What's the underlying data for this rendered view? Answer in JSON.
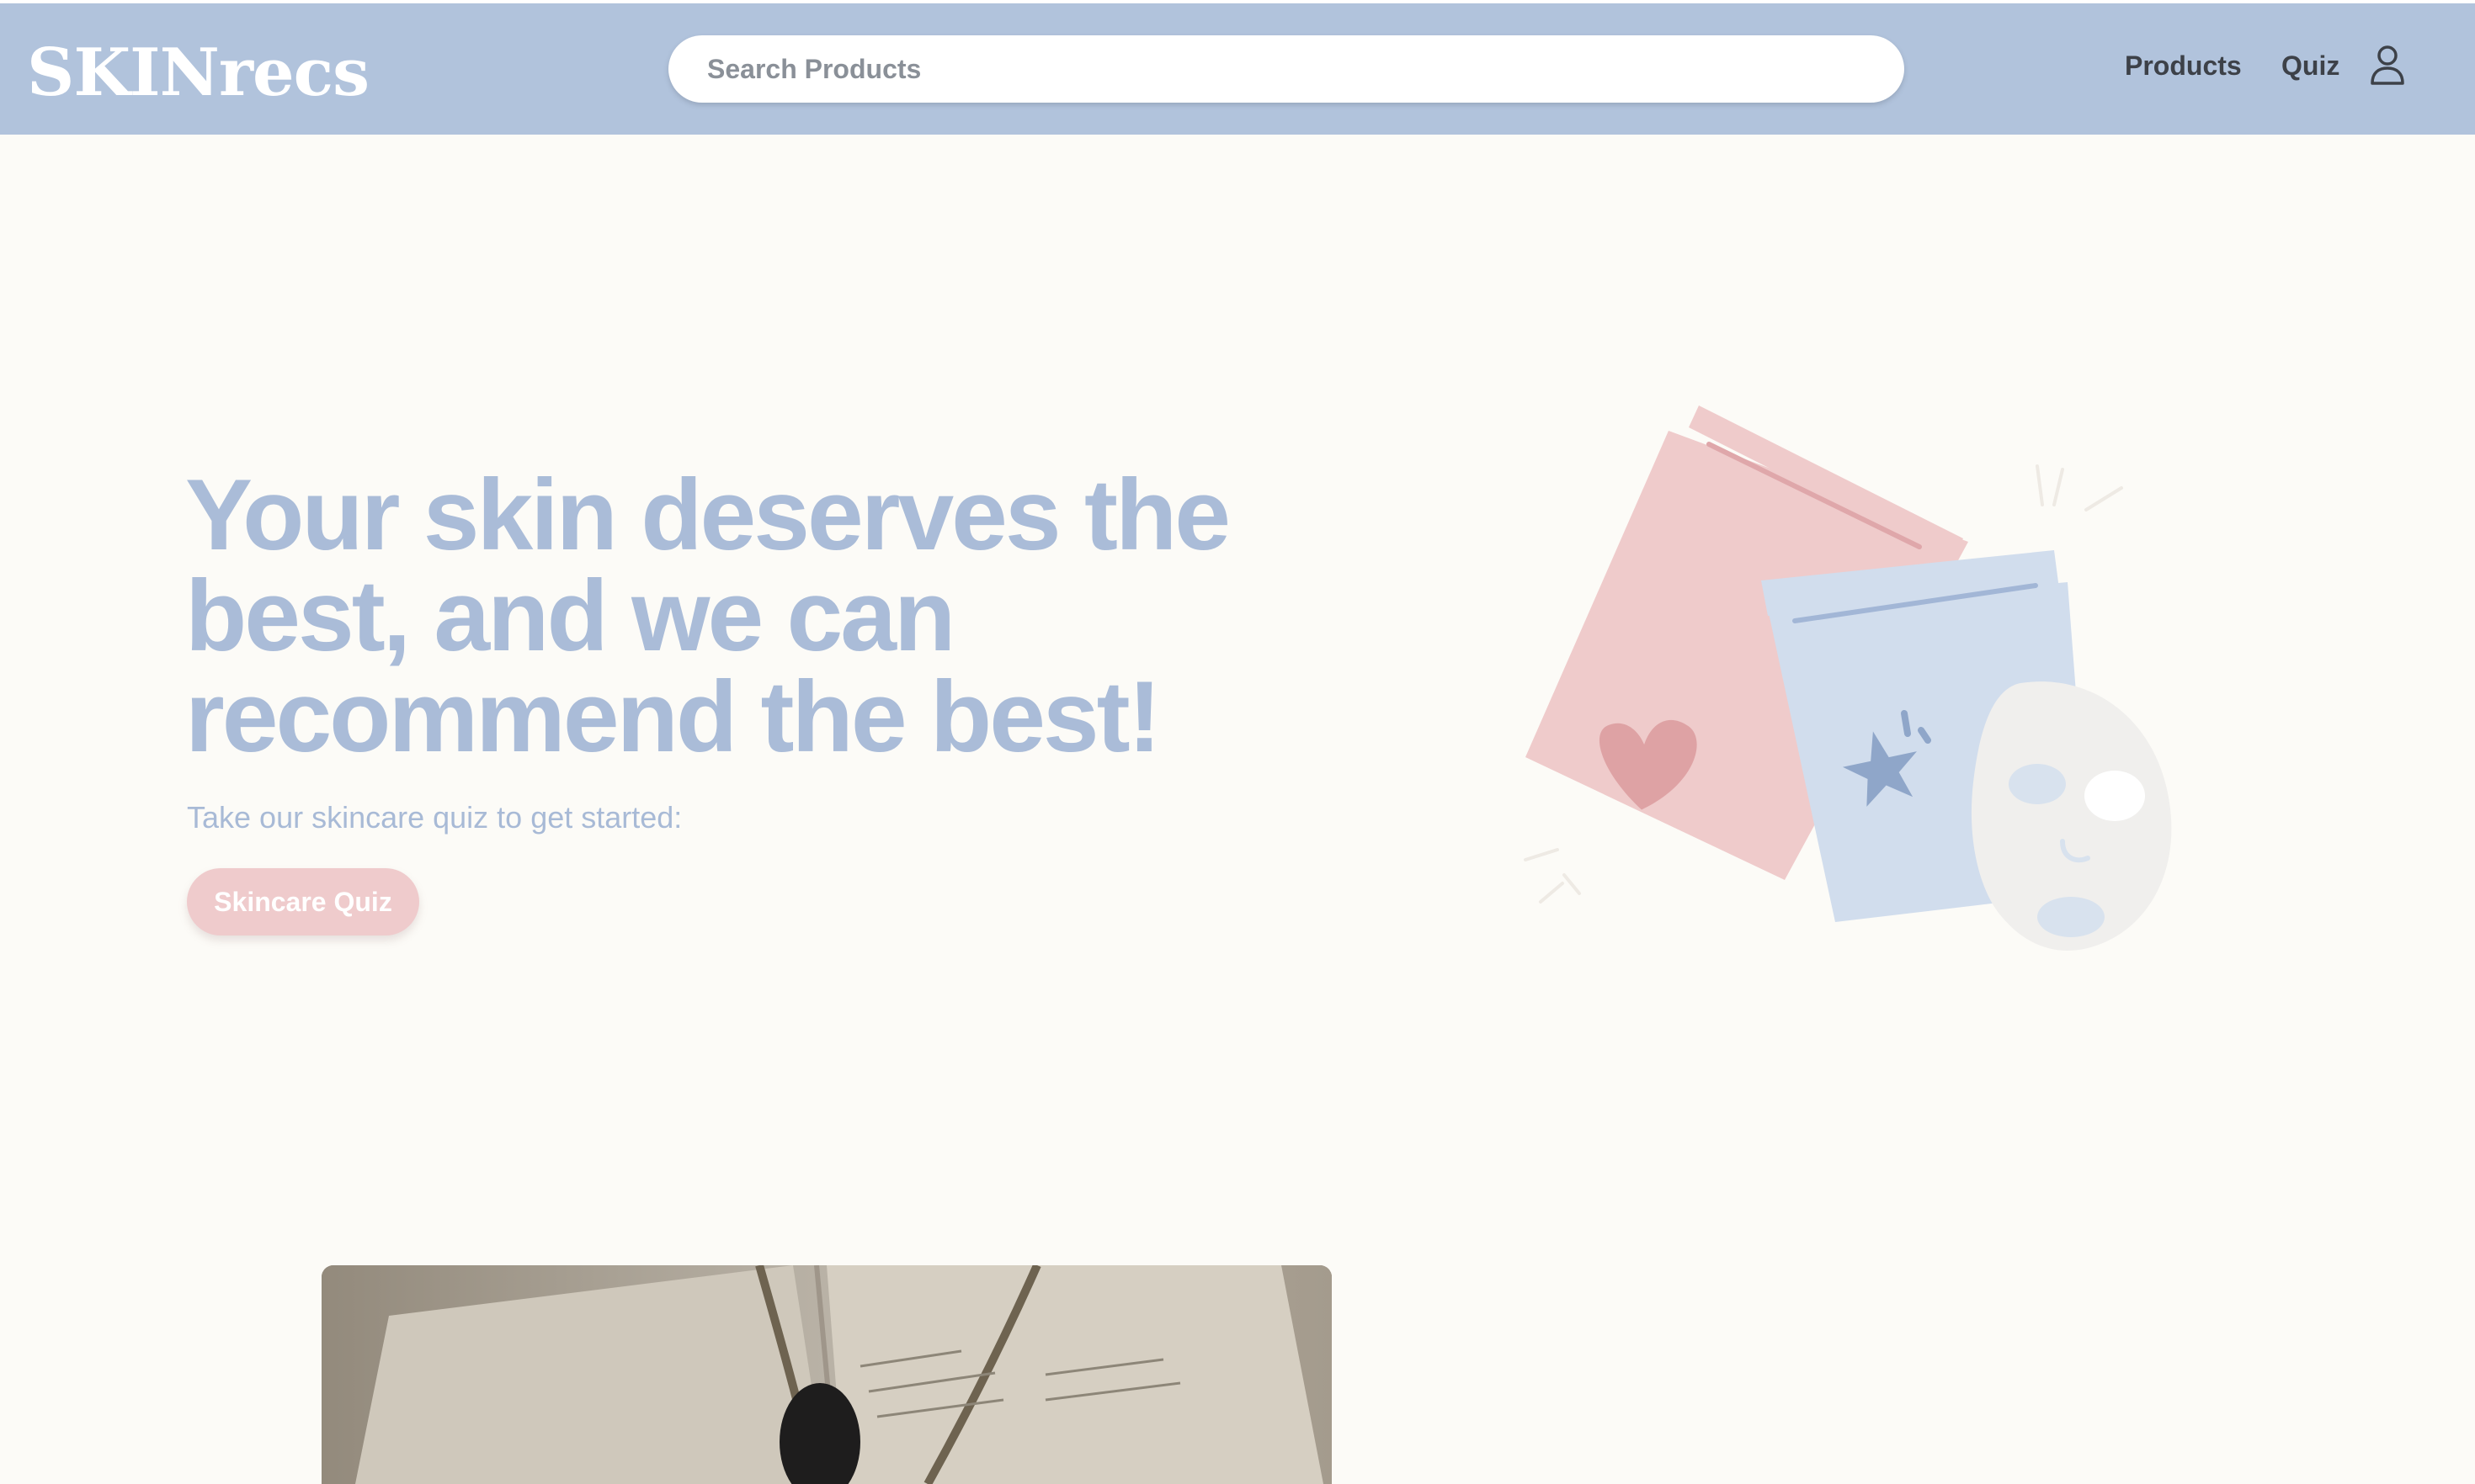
{
  "header": {
    "logo_text": "SKINrecs",
    "search": {
      "placeholder": "Search Products",
      "value": ""
    },
    "nav": {
      "products_label": "Products",
      "quiz_label": "Quiz",
      "account_icon": "user-icon"
    }
  },
  "hero": {
    "headline": "Your skin deserves the best, and we can recommend the best!",
    "subtext": "Take our skincare quiz to get started:",
    "cta_label": "Skincare Quiz",
    "illustration_icons": [
      "jar-with-heart-icon",
      "jar-with-star-icon",
      "sheet-mask-icon"
    ]
  },
  "media": {
    "video_preview": "book-and-dropper-photo"
  },
  "colors": {
    "navbar": "#b1c3dc",
    "background": "#fcfbf7",
    "headline": "#aabcd8",
    "cta_background": "#efcbcc",
    "jar_pink": "#efcbcb",
    "jar_blue": "#d1dded"
  }
}
